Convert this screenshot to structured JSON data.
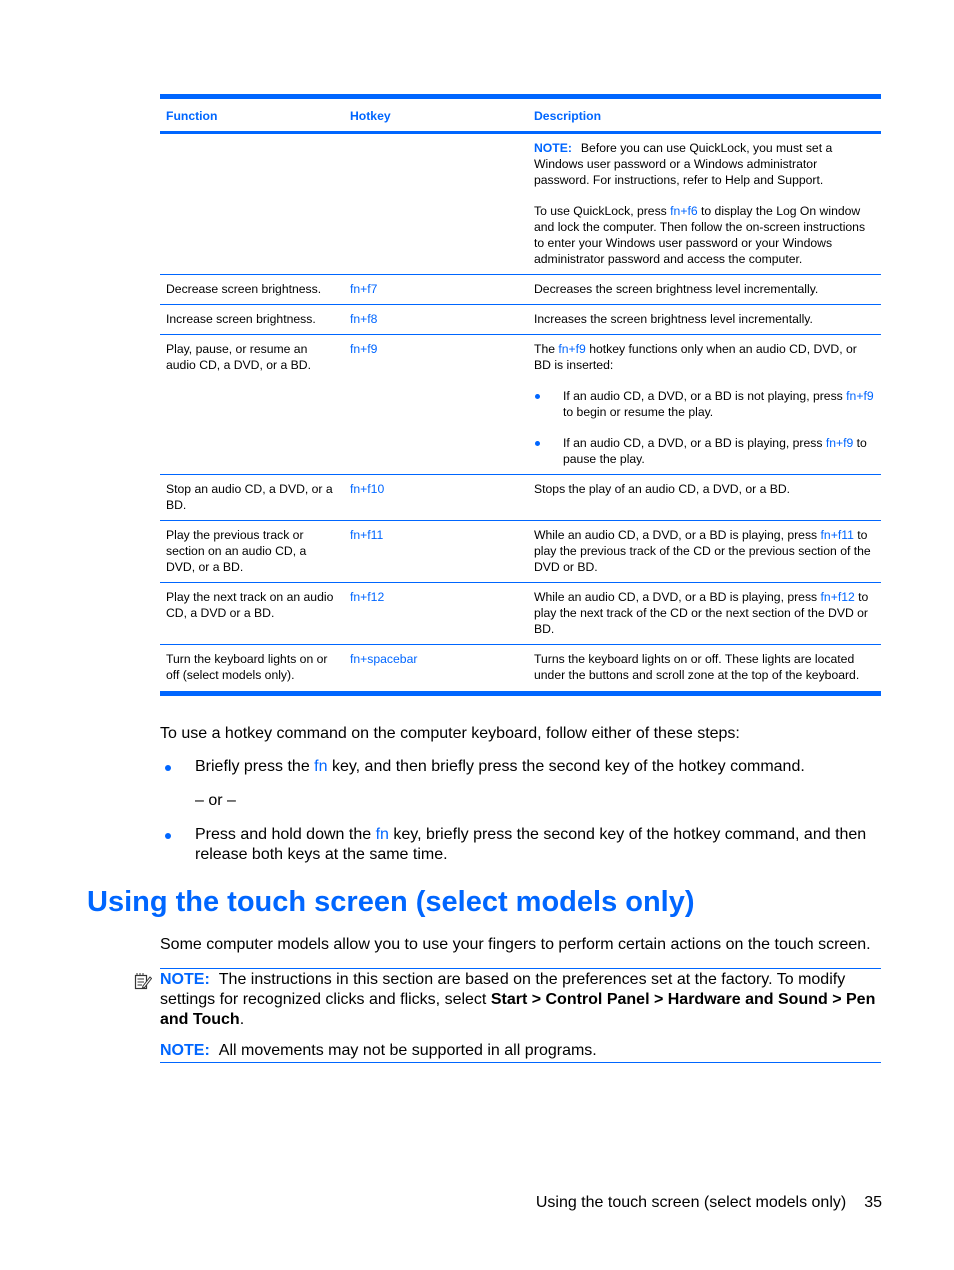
{
  "table": {
    "headers": {
      "function": "Function",
      "hotkey": "Hotkey",
      "description": "Description"
    },
    "quicklock": {
      "note_label": "NOTE:",
      "note_text": "Before you can use QuickLock, you must set a Windows user password or a Windows administrator password. For instructions, refer to Help and Support.",
      "para_pre": "To use QuickLock, press ",
      "para_key": "fn+f6",
      "para_post": " to display the Log On window and lock the computer. Then follow the on-screen instructions to enter your Windows user password or your Windows administrator password and access the computer."
    },
    "rows": [
      {
        "function": "Decrease screen brightness.",
        "hotkey": "fn+f7",
        "description": "Decreases the screen brightness level incrementally."
      },
      {
        "function": "Increase screen brightness.",
        "hotkey": "fn+f8",
        "description": "Increases the screen brightness level incrementally."
      },
      {
        "function": "Play, pause, or resume an audio CD, a DVD, or a BD.",
        "hotkey": "fn+f9",
        "desc_pre": "The ",
        "desc_key": "fn+f9",
        "desc_post": " hotkey functions only when an audio CD, DVD, or BD is inserted:",
        "bullets": [
          {
            "pre": "If an audio CD, a DVD, or a BD is not playing, press ",
            "key": "fn+f9",
            "post": " to begin or resume the play."
          },
          {
            "pre": "If an audio CD, a DVD, or a BD is playing, press ",
            "key": "fn+f9",
            "post": " to pause the play."
          }
        ]
      },
      {
        "function": "Stop an audio CD, a DVD, or a BD.",
        "hotkey": "fn+f10",
        "description": "Stops the play of an audio CD, a DVD, or a BD."
      },
      {
        "function": "Play the previous track or section on an audio CD, a DVD, or a BD.",
        "hotkey": "fn+f11",
        "desc_pre": "While an audio CD, a DVD, or a BD is playing, press ",
        "desc_key": "fn+f11",
        "desc_post": " to play the previous track of the CD or the previous section of the DVD or BD."
      },
      {
        "function": "Play the next track on an audio CD, a DVD or a BD.",
        "hotkey": "fn+f12",
        "desc_pre": "While an audio CD, a DVD, or a BD is playing, press ",
        "desc_key": "fn+f12",
        "desc_post": " to play the next track of the CD or the next section of the DVD or BD."
      },
      {
        "function": "Turn the keyboard lights on or off (select models only).",
        "hotkey": "fn+spacebar",
        "description": "Turns the keyboard lights on or off. These lights are located under the buttons and scroll zone at the top of the keyboard."
      }
    ]
  },
  "instructions": {
    "intro": "To use a hotkey command on the computer keyboard, follow either of these steps:",
    "step1_pre": "Briefly press the ",
    "step1_key": "fn",
    "step1_post": " key, and then briefly press the second key of the hotkey command.",
    "or": "– or –",
    "step2_pre": "Press and hold down the ",
    "step2_key": "fn",
    "step2_post": " key, briefly press the second key of the hotkey command, and then release both keys at the same time."
  },
  "section": {
    "title": "Using the touch screen (select models only)",
    "intro": "Some computer models allow you to use your fingers to perform certain actions on the touch screen.",
    "note1_label": "NOTE:",
    "note1_pre": "The instructions in this section are based on the preferences set at the factory. To modify settings for recognized clicks and flicks, select ",
    "note1_path": "Start > Control Panel > Hardware and Sound > Pen and Touch",
    "note1_post": ".",
    "note2_label": "NOTE:",
    "note2_text": "All movements may not be supported in all programs.",
    "note_icon": "note-pad-icon"
  },
  "footer": {
    "text": "Using the touch screen (select models only)",
    "page_number": "35"
  },
  "colors": {
    "accent": "#0066ff",
    "text": "#000000"
  }
}
